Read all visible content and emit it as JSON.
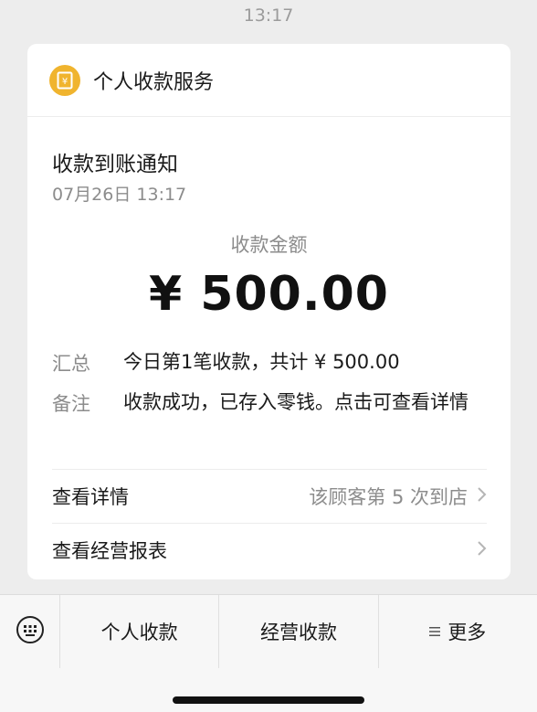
{
  "status": {
    "time": "13:17"
  },
  "card": {
    "service_name": "个人收款服务",
    "title": "收款到账通知",
    "datetime": "07月26日 13:17",
    "amount_label": "收款金额",
    "amount": "¥ 500.00",
    "summary": {
      "key": "汇总",
      "value": "今日第1笔收款，共计 ¥ 500.00"
    },
    "remark": {
      "key": "备注",
      "value": "收款成功，已存入零钱。点击可查看详情"
    },
    "detail_row": {
      "label": "查看详情",
      "hint": "该顾客第 5 次到店"
    },
    "report_row": {
      "label": "查看经营报表"
    }
  },
  "bottom_menu": {
    "items": [
      {
        "label": "个人收款"
      },
      {
        "label": "经营收款"
      },
      {
        "label": "更多"
      }
    ]
  },
  "colors": {
    "background": "#ededed",
    "card": "#ffffff",
    "service_icon": "#f0b42e",
    "secondary_text": "#8c8c8c"
  },
  "icons": {
    "service": "wallet-icon",
    "keyboard": "keyboard-icon",
    "more": "list-icon",
    "chevron": "chevron-right-icon"
  }
}
